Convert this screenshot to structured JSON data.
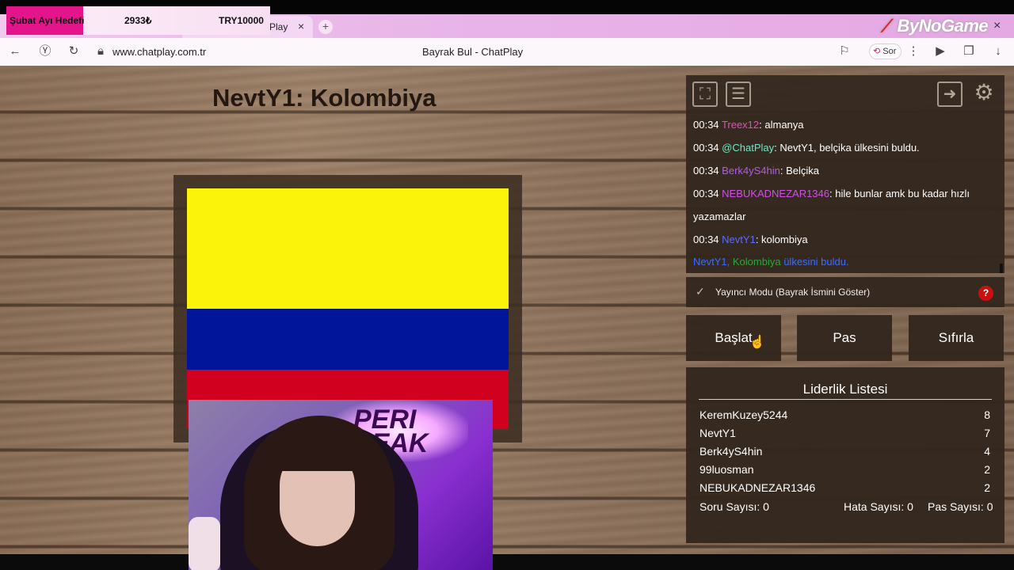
{
  "browser": {
    "tab_label": "Play",
    "tab_close": "×",
    "new_tab": "+",
    "brand": "ByNoGame",
    "window_close": "×",
    "url": "www.chatplay.com.tr",
    "title": "Bayrak Bul - ChatPlay",
    "sor_label": "Sor"
  },
  "goal": {
    "title": "Şubat Ayı Hedefi",
    "current": "2933₺",
    "target": "TRY10000",
    "progress": 0.29
  },
  "game": {
    "question": "NevtY1: Kolombiya",
    "flag_colors": [
      "#fcf30a",
      "#00159a",
      "#d1001f"
    ]
  },
  "webcam": {
    "sign_text": "PERI\nPEAK"
  },
  "chat": {
    "messages": [
      {
        "time": "00:34",
        "user": "Treex12",
        "user_color": "#e24fbd",
        "text": ": almanya"
      },
      {
        "time": "00:34",
        "user": "@ChatPlay",
        "user_color": "#6fe7c7",
        "text": ": NevtY1, belçika ülkesini buldu."
      },
      {
        "time": "00:34",
        "user": "Berk4yS4hin",
        "user_color": "#b25af0",
        "text": ": Belçika"
      },
      {
        "time": "00:34",
        "user": "NEBUKADNEZAR1346",
        "user_color": "#d04fe8",
        "text": ": hile bunlar amk bu kadar hızlı"
      },
      {
        "time": "",
        "user": "",
        "user_color": "#ffffff",
        "text": "yazamazlar"
      },
      {
        "time": "00:34",
        "user": "NevtY1",
        "user_color": "#5b6cff",
        "text": ": kolombiya"
      }
    ],
    "system": {
      "user": "NevtY1,",
      "country": "Kolombiya",
      "rest": "ülkesini buldu."
    }
  },
  "mode": {
    "label": "Yayıncı Modu (Bayrak İsmini Göster)",
    "help": "?"
  },
  "buttons": {
    "start": "Başlat",
    "pass": "Pas",
    "reset": "Sıfırla"
  },
  "leaderboard": {
    "title": "Liderlik Listesi",
    "rows": [
      {
        "name": "KeremKuzey5244",
        "score": "8"
      },
      {
        "name": "NevtY1",
        "score": "7"
      },
      {
        "name": "Berk4yS4hin",
        "score": "4"
      },
      {
        "name": "99luosman",
        "score": "2"
      },
      {
        "name": "NEBUKADNEZAR1346",
        "score": "2"
      }
    ],
    "questions": "Soru Sayısı: 0",
    "errors": "Hata Sayısı: 0",
    "passes": "Pas Sayısı: 0"
  },
  "icons": [
    "expand-icon",
    "document-icon",
    "exit-icon",
    "gear-icon",
    "back-icon",
    "yandex-icon",
    "refresh-icon",
    "lock-icon",
    "bookmark-icon",
    "more-icon",
    "media-icon",
    "collections-icon",
    "download-icon"
  ]
}
